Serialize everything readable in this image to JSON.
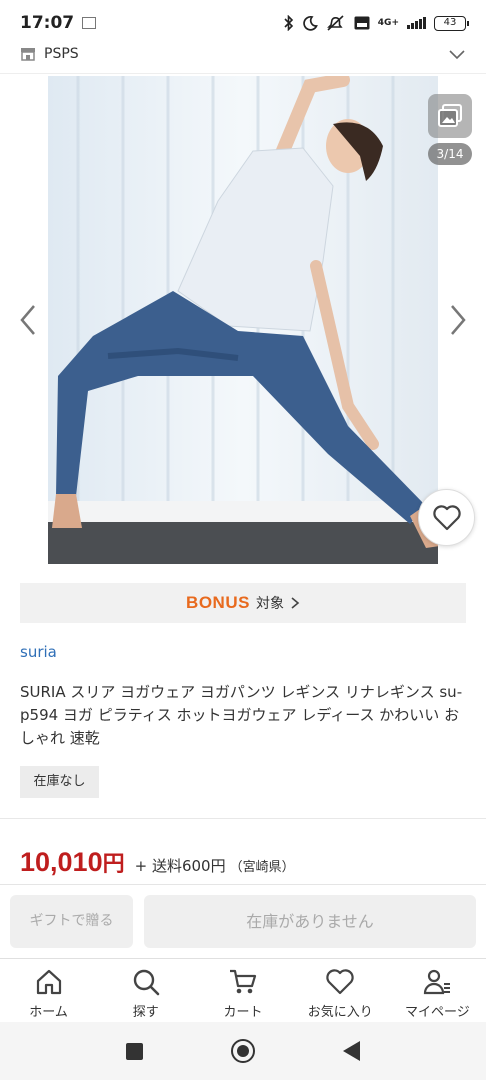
{
  "status_bar": {
    "time": "17:07",
    "network": "4G+",
    "battery": "43"
  },
  "shop": {
    "name": "PSPS"
  },
  "gallery": {
    "counter": "3/14"
  },
  "bonus": {
    "logo": "BONUS",
    "label": "対象"
  },
  "product": {
    "brand": "suria",
    "title": "SURIA スリア ヨガウェア ヨガパンツ レギンス リナレギンス su-p594 ヨガ ピラティス ホットヨガウェア レディース かわいい おしゃれ 速乾",
    "stock_status": "在庫なし",
    "price": "10,010",
    "price_unit": "円",
    "shipping": "+ 送料600円",
    "shipping_region": "（宮崎県）"
  },
  "actions": {
    "gift": "ギフトで贈る",
    "out_of_stock": "在庫がありません"
  },
  "tabs": [
    {
      "label": "ホーム",
      "icon": "home-icon"
    },
    {
      "label": "探す",
      "icon": "search-icon"
    },
    {
      "label": "カート",
      "icon": "cart-icon"
    },
    {
      "label": "お気に入り",
      "icon": "heart-icon"
    },
    {
      "label": "マイページ",
      "icon": "user-icon"
    }
  ],
  "colors": {
    "price": "#bf1e1e",
    "brand_link": "#2f6fb7",
    "bonus": "#e86a1e"
  }
}
